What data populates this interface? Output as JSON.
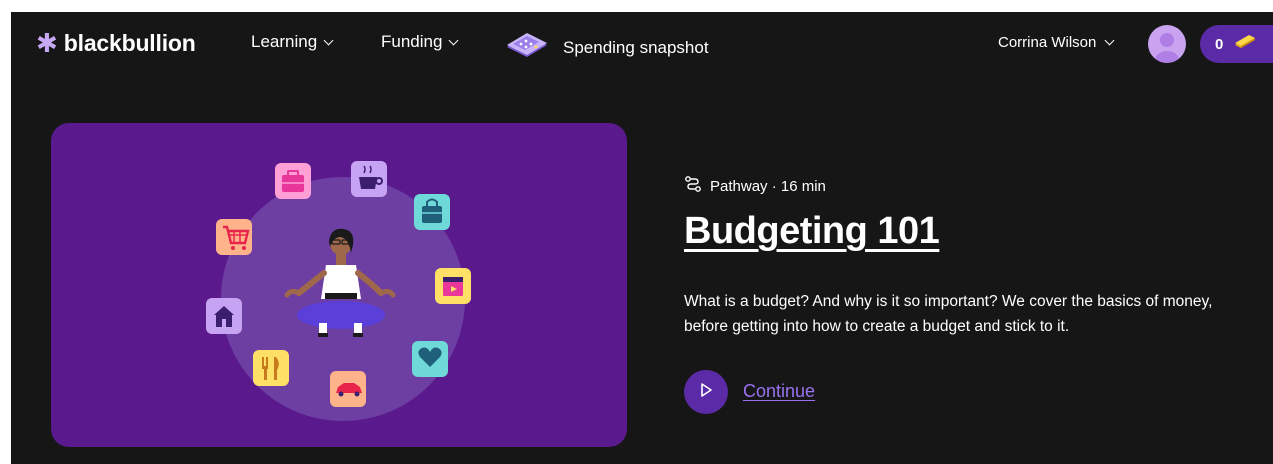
{
  "brand": {
    "name": "blackbullion",
    "star": "✱"
  },
  "nav": {
    "items": [
      {
        "label": "Learning",
        "has_dropdown": true
      },
      {
        "label": "Funding",
        "has_dropdown": true
      }
    ],
    "spending_snapshot": {
      "label": "Spending snapshot",
      "icon": "calculator-icon"
    }
  },
  "user": {
    "name": "Corrina Wilson",
    "points": "0",
    "points_icon": "gold-bar-icon"
  },
  "course": {
    "meta": "Pathway · 16 min",
    "meta_icon": "pathway-icon",
    "title": "Budgeting 101",
    "description": "What is a budget? And why is it so important? We cover the basics of money, before getting into how to create a budget and stick to it.",
    "cta": "Continue"
  },
  "illustration": {
    "icons": [
      "suitcase-icon",
      "coffee-cup-icon",
      "shopping-bag-icon",
      "film-clapper-icon",
      "heart-icon",
      "car-icon",
      "cutlery-icon",
      "house-icon",
      "shopping-cart-icon"
    ]
  },
  "colors": {
    "background": "#161616",
    "accent": "#5b2aa6",
    "card": "#5a1a8e",
    "link": "#9a72f0"
  }
}
